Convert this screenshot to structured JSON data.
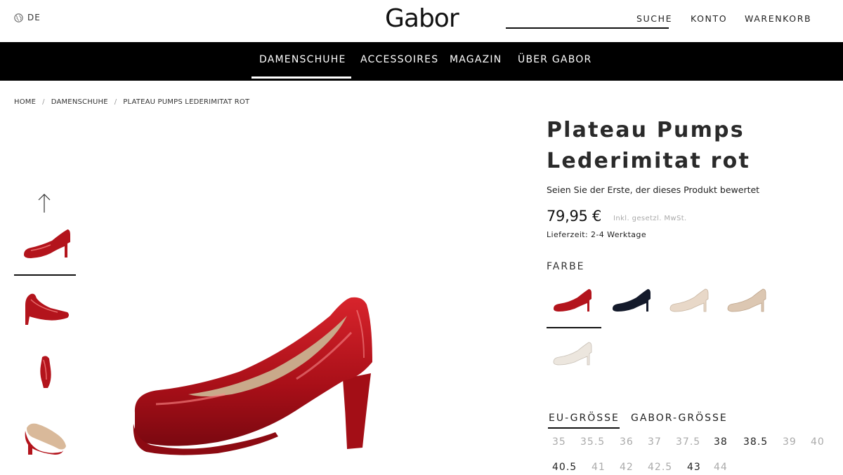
{
  "header": {
    "language": "DE",
    "logo": "Gabor",
    "links": {
      "search": "SUCHE",
      "account": "KONTO",
      "cart": "WARENKORB"
    }
  },
  "nav": {
    "items": [
      "DAMENSCHUHE",
      "ACCESSOIRES",
      "MAGAZIN",
      "ÜBER GABOR"
    ],
    "active": "DAMENSCHUHE"
  },
  "breadcrumb": [
    "HOME",
    "DAMENSCHUHE",
    "PLATEAU PUMPS LEDERIMITAT ROT"
  ],
  "product": {
    "title_line1": "Plateau Pumps",
    "title_line2": "Lederimitat rot",
    "review_text": "Seien Sie der Erste, der dieses Produkt bewertet",
    "price": "79,95 €",
    "tax_note": "Inkl. gesetzl. MwSt.",
    "delivery": "Lieferzeit: 2-4 Werktage",
    "color_label": "FARBE",
    "colors": [
      {
        "name": "rot",
        "hex": "#b3141c"
      },
      {
        "name": "schwarz",
        "hex": "#141a2b"
      },
      {
        "name": "beige",
        "hex": "#e8d8c8"
      },
      {
        "name": "nude",
        "hex": "#dcc7b2"
      },
      {
        "name": "creme",
        "hex": "#ece6de"
      }
    ],
    "size_tabs": [
      "EU-GRÖSSE",
      "GABOR-GRÖSSE"
    ],
    "sizes_row1": [
      {
        "label": "35",
        "available": false
      },
      {
        "label": "35.5",
        "available": false
      },
      {
        "label": "36",
        "available": false
      },
      {
        "label": "37",
        "available": false
      },
      {
        "label": "37.5",
        "available": false
      },
      {
        "label": "38",
        "available": true
      },
      {
        "label": "38.5",
        "available": true
      },
      {
        "label": "39",
        "available": false
      },
      {
        "label": "40",
        "available": false
      }
    ],
    "sizes_row2": [
      {
        "label": "40.5",
        "available": true
      },
      {
        "label": "41",
        "available": false
      },
      {
        "label": "42",
        "available": false
      },
      {
        "label": "42.5",
        "available": false
      },
      {
        "label": "43",
        "available": true
      },
      {
        "label": "44",
        "available": false
      }
    ]
  },
  "icons": {
    "globe": "globe-icon",
    "up_arrow": "arrow-up-icon"
  }
}
